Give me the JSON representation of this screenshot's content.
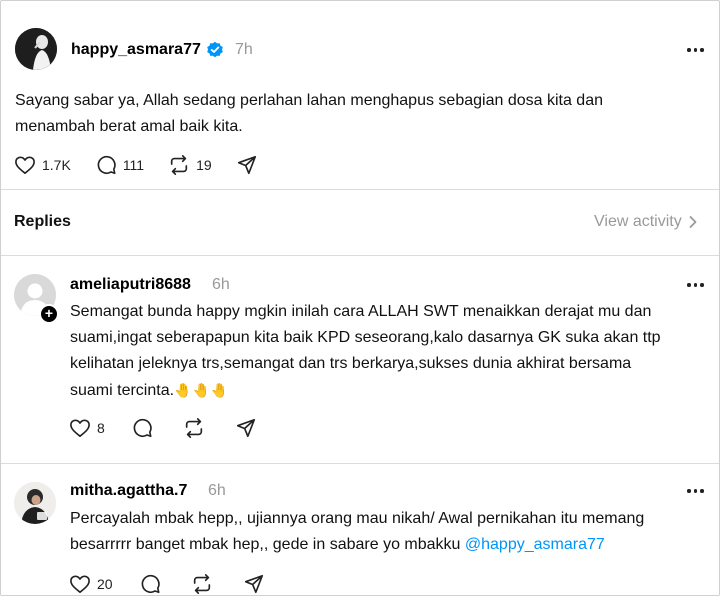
{
  "post": {
    "username": "happy_asmara77",
    "verified": true,
    "time": "7h",
    "text_line1": "Sayang sabar ya, Allah sedang perlahan lahan menghapus sebagian dosa kita dan",
    "text_line2": "menambah berat amal baik kita.",
    "likes": "1.7K",
    "comments": "111",
    "reposts": "19"
  },
  "replies_header": {
    "title": "Replies",
    "view_activity": "View activity"
  },
  "replies": [
    {
      "username": "ameliaputri8688",
      "time": "6h",
      "lines": [
        "Semangat bunda happy mgkin inilah cara ALLAH SWT menaikkan derajat mu dan",
        "suami,ingat seberapapun kita baik KPD seseorang,kalo dasarnya GK suka akan ttp",
        "kelihatan jeleknya trs,semangat dan trs berkarya,sukses dunia akhirat bersama",
        "suami tercinta."
      ],
      "emoji": "🤚🤚🤚",
      "likes": "8"
    },
    {
      "username": "mitha.agattha.7",
      "time": "6h",
      "lines": [
        "Percayalah mbak hepp,, ujiannya orang mau nikah/ Awal pernikahan itu memang",
        "besarrrrr banget mbak hep,, gede in sabare yo mbakku "
      ],
      "mention": "@happy_asmara77",
      "likes": "20"
    }
  ],
  "colors": {
    "verified": "#0095f6",
    "mention": "#0095f6",
    "muted": "#999999",
    "divider": "#dbdbdb"
  }
}
